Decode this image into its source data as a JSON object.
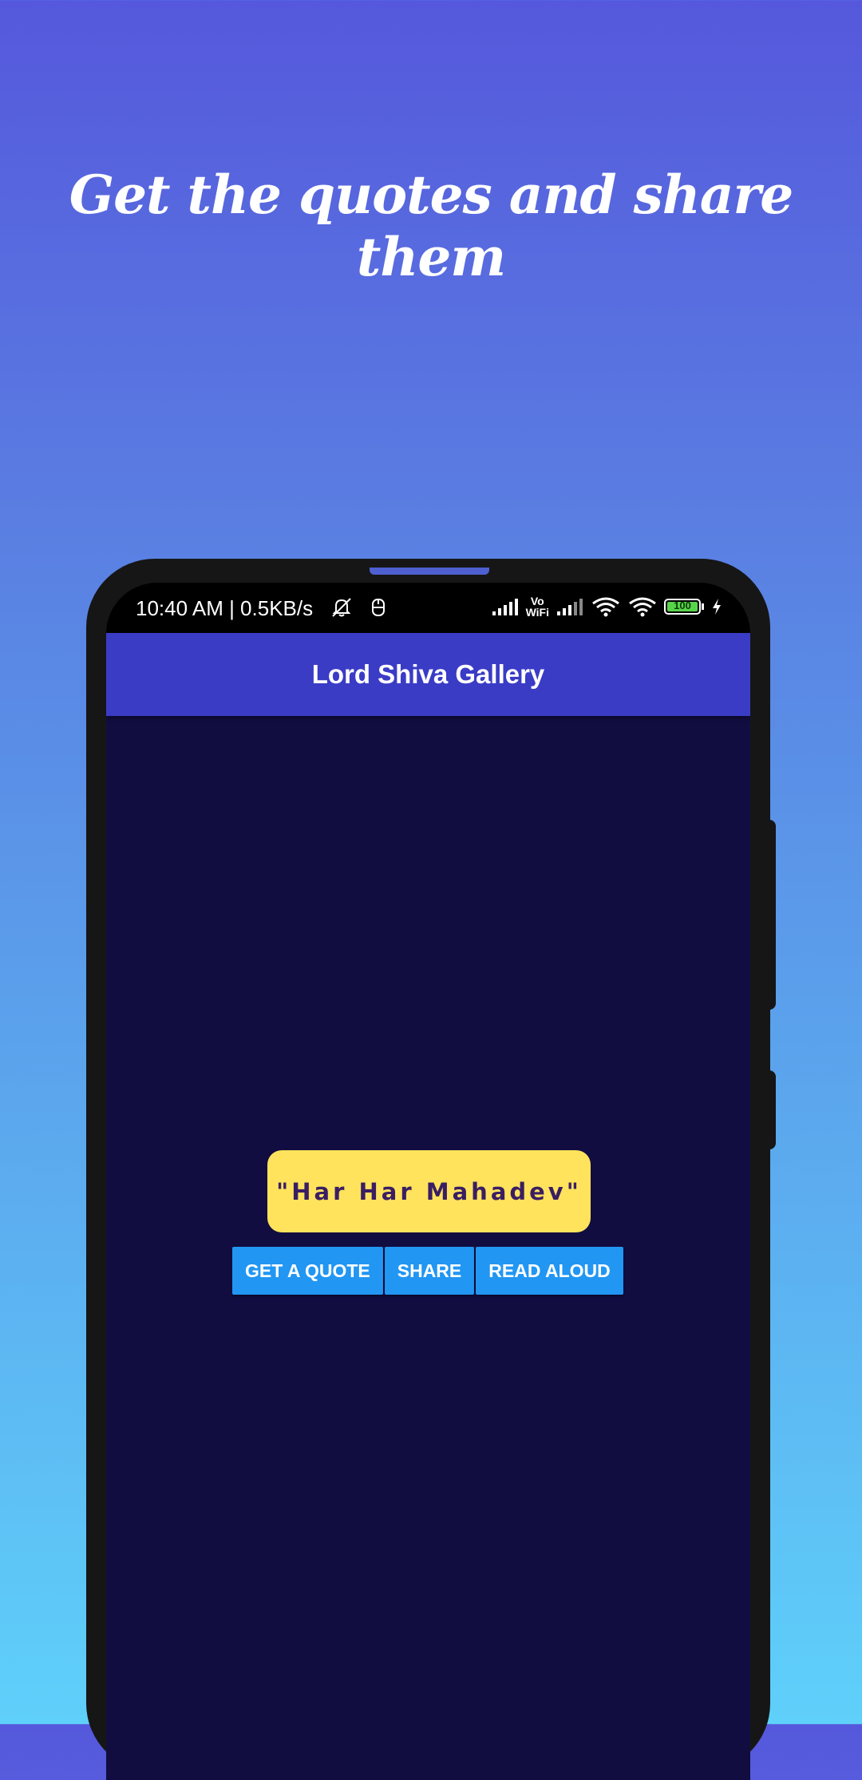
{
  "promo": {
    "headline": "Get the quotes and share them"
  },
  "status_bar": {
    "time_speed": "10:40 AM | 0.5KB/s",
    "vowifi_top": "Vo",
    "vowifi_bottom": "WiFi",
    "battery_level": "100",
    "icons": [
      "mute-bell-icon",
      "app-notification-icon",
      "signal-icon",
      "vowifi-icon",
      "signal-icon",
      "wifi-icon",
      "wifi-icon",
      "battery-icon",
      "charging-icon"
    ]
  },
  "app_bar": {
    "title": "Lord Shiva Gallery"
  },
  "quote": {
    "text": "\"Har Har Mahadev\""
  },
  "actions": {
    "get_quote": "GET A QUOTE",
    "share": "SHARE",
    "read_aloud": "READ ALOUD"
  },
  "colors": {
    "app_bar": "#3a3cc6",
    "screen_bg": "#120d40",
    "quote_card": "#ffe35c",
    "quote_text": "#3a1e63",
    "button": "#2196f3"
  }
}
